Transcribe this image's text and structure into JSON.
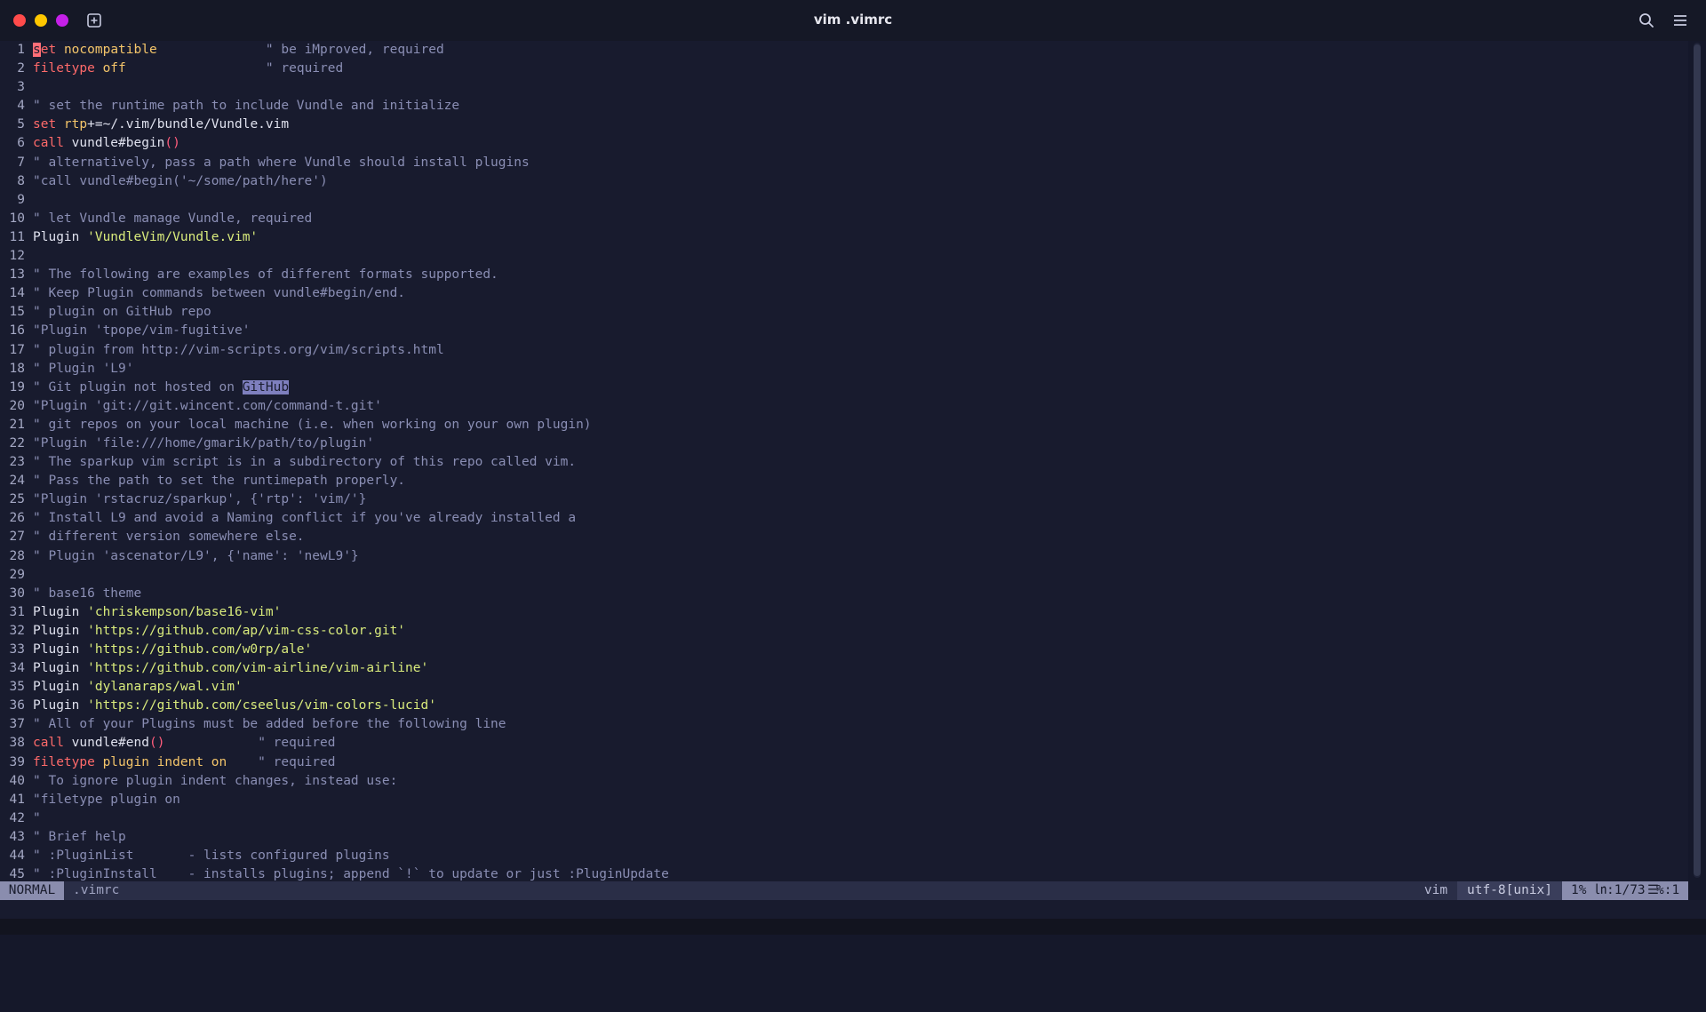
{
  "window": {
    "title": "vim .vimrc"
  },
  "editor": {
    "lines": [
      [
        [
          "cursor",
          "s"
        ],
        [
          "k",
          "et "
        ],
        [
          "y",
          "nocompatible"
        ],
        [
          "c",
          "              \" be iMproved, required"
        ]
      ],
      [
        [
          "k",
          "filetype "
        ],
        [
          "y",
          "off"
        ],
        [
          "c",
          "                  \" required"
        ]
      ],
      [],
      [
        [
          "c",
          "\" set the runtime path to include Vundle and initialize"
        ]
      ],
      [
        [
          "k",
          "set "
        ],
        [
          "y",
          "rtp"
        ],
        [
          "n",
          "+=~/.vim/bundle/Vundle.vim"
        ]
      ],
      [
        [
          "k",
          "call "
        ],
        [
          "n",
          "vundle#begin"
        ],
        [
          "p",
          "()"
        ]
      ],
      [
        [
          "c",
          "\" alternatively, pass a path where Vundle should install plugins"
        ]
      ],
      [
        [
          "c",
          "\"call vundle#begin('~/some/path/here')"
        ]
      ],
      [],
      [
        [
          "c",
          "\" let Vundle manage Vundle, required"
        ]
      ],
      [
        [
          "n",
          "Plugin "
        ],
        [
          "s",
          "'VundleVim/Vundle.vim'"
        ]
      ],
      [],
      [
        [
          "c",
          "\" The following are examples of different formats supported."
        ]
      ],
      [
        [
          "c",
          "\" Keep Plugin commands between vundle#begin/end."
        ]
      ],
      [
        [
          "c",
          "\" plugin on GitHub repo"
        ]
      ],
      [
        [
          "c",
          "\"Plugin 'tpope/vim-fugitive'"
        ]
      ],
      [
        [
          "c",
          "\" plugin from http://vim-scripts.org/vim/scripts.html"
        ]
      ],
      [
        [
          "c",
          "\" Plugin 'L9'"
        ]
      ],
      [
        [
          "c",
          "\" Git plugin not hosted on "
        ],
        [
          "hl",
          "GitHub"
        ]
      ],
      [
        [
          "c",
          "\"Plugin 'git://git.wincent.com/command-t.git'"
        ]
      ],
      [
        [
          "c",
          "\" git repos on your local machine (i.e. when working on your own plugin)"
        ]
      ],
      [
        [
          "c",
          "\"Plugin 'file:///home/gmarik/path/to/plugin'"
        ]
      ],
      [
        [
          "c",
          "\" The sparkup vim script is in a subdirectory of this repo called vim."
        ]
      ],
      [
        [
          "c",
          "\" Pass the path to set the runtimepath properly."
        ]
      ],
      [
        [
          "c",
          "\"Plugin 'rstacruz/sparkup', {'rtp': 'vim/'}"
        ]
      ],
      [
        [
          "c",
          "\" Install L9 and avoid a Naming conflict if you've already installed a"
        ]
      ],
      [
        [
          "c",
          "\" different version somewhere else."
        ]
      ],
      [
        [
          "c",
          "\" Plugin 'ascenator/L9', {'name': 'newL9'}"
        ]
      ],
      [],
      [
        [
          "c",
          "\" base16 theme"
        ]
      ],
      [
        [
          "n",
          "Plugin "
        ],
        [
          "s",
          "'chriskempson/base16-vim'"
        ]
      ],
      [
        [
          "n",
          "Plugin "
        ],
        [
          "s",
          "'https://github.com/ap/vim-css-color.git'"
        ]
      ],
      [
        [
          "n",
          "Plugin "
        ],
        [
          "s",
          "'https://github.com/w0rp/ale'"
        ]
      ],
      [
        [
          "n",
          "Plugin "
        ],
        [
          "s",
          "'https://github.com/vim-airline/vim-airline'"
        ]
      ],
      [
        [
          "n",
          "Plugin "
        ],
        [
          "s",
          "'dylanaraps/wal.vim'"
        ]
      ],
      [
        [
          "n",
          "Plugin "
        ],
        [
          "s",
          "'https://github.com/cseelus/vim-colors-lucid'"
        ]
      ],
      [
        [
          "c",
          "\" All of your Plugins must be added before the following line"
        ]
      ],
      [
        [
          "k",
          "call "
        ],
        [
          "n",
          "vundle#end"
        ],
        [
          "p",
          "()"
        ],
        [
          "c",
          "            \" required"
        ]
      ],
      [
        [
          "k",
          "filetype "
        ],
        [
          "y",
          "plugin indent on"
        ],
        [
          "c",
          "    \" required"
        ]
      ],
      [
        [
          "c",
          "\" To ignore plugin indent changes, instead use:"
        ]
      ],
      [
        [
          "c",
          "\"filetype plugin on"
        ]
      ],
      [
        [
          "c",
          "\""
        ]
      ],
      [
        [
          "c",
          "\" Brief help"
        ]
      ],
      [
        [
          "c",
          "\" :PluginList       - lists configured plugins"
        ]
      ],
      [
        [
          "c",
          "\" :PluginInstall    - installs plugins; append `!` to update or just :PluginUpdate"
        ]
      ]
    ]
  },
  "statusline": {
    "mode": "NORMAL",
    "filename": ".vimrc",
    "filetype": "vim",
    "encoding": "utf-8[unix]",
    "percent": "1%",
    "ln_icon": "㏑",
    "position": ":1/73",
    "col_icon": "☰",
    "col": "%:1"
  },
  "colors": {
    "background": "#181b2e",
    "comment": "#8a8eb4",
    "keyword": "#ff6a6a",
    "option": "#f4c56a",
    "string": "#d9eb7c",
    "mode_bg": "#8a8dae"
  },
  "icons": {
    "close": "close-dot",
    "minimize": "minimize-dot",
    "maximize": "maximize-dot",
    "new_tab": "plus-square-icon",
    "search": "search-icon",
    "menu": "hamburger-menu-icon"
  }
}
